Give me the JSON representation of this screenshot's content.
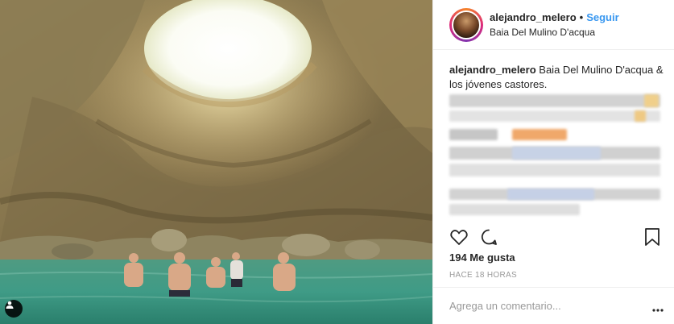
{
  "header": {
    "username": "alejandro_melero",
    "separator": "•",
    "follow_label": "Seguir",
    "location": "Baia Del Mulino D'acqua"
  },
  "caption": {
    "username": "alejandro_melero",
    "text": "Baia Del Mulino D'acqua & los jóvenes castores."
  },
  "likes": "194 Me gusta",
  "timestamp": "HACE 18 HORAS",
  "comment": {
    "placeholder": "Agrega un comentario...",
    "value": ""
  },
  "icons": {
    "tag": "person-tag-icon",
    "like": "heart-icon",
    "comment": "comment-bubble-icon",
    "save": "bookmark-icon",
    "more": "more-options-icon"
  },
  "colors": {
    "follow": "#3897f0",
    "muted": "#999999",
    "text": "#262626",
    "border": "#efefef"
  }
}
